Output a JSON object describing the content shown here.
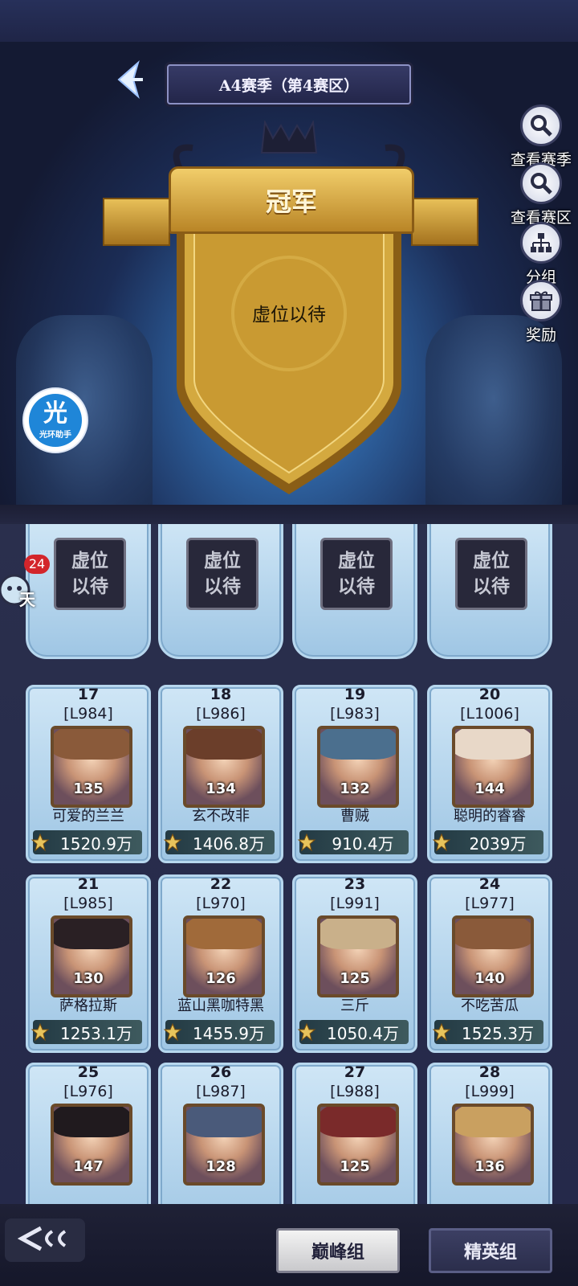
{
  "header": {
    "title": "A4赛季（第4赛区）",
    "back_icon": "back-arrow-icon"
  },
  "side_buttons": [
    {
      "label": "查看赛季",
      "icon": "search-icon"
    },
    {
      "label": "查看赛区",
      "icon": "search-icon"
    },
    {
      "label": "分组",
      "icon": "group-tree-icon"
    },
    {
      "label": "奖励",
      "icon": "gift-icon"
    }
  ],
  "champion": {
    "banner": "冠军",
    "placeholder": "虚位以待"
  },
  "helper": {
    "glyph": "光",
    "label": "光环助手"
  },
  "chat": {
    "badge": "24",
    "label": "天"
  },
  "placeholder_slots": [
    {
      "line1": "虚位",
      "line2": "以待"
    },
    {
      "line1": "虚位",
      "line2": "以待"
    },
    {
      "line1": "虚位",
      "line2": "以待"
    },
    {
      "line1": "虚位",
      "line2": "以待"
    }
  ],
  "players": [
    {
      "rank": "17",
      "level": "[L984]",
      "portrait_value": "135",
      "name": "可爱的兰兰",
      "power": "1520.9万"
    },
    {
      "rank": "18",
      "level": "[L986]",
      "portrait_value": "134",
      "name": "玄不改非",
      "power": "1406.8万"
    },
    {
      "rank": "19",
      "level": "[L983]",
      "portrait_value": "132",
      "name": "曹贼",
      "power": "910.4万"
    },
    {
      "rank": "20",
      "level": "[L1006]",
      "portrait_value": "144",
      "name": "聪明的睿睿",
      "power": "2039万"
    },
    {
      "rank": "21",
      "level": "[L985]",
      "portrait_value": "130",
      "name": "萨格拉斯",
      "power": "1253.1万"
    },
    {
      "rank": "22",
      "level": "[L970]",
      "portrait_value": "126",
      "name": "蓝山黑咖特黑",
      "power": "1455.9万"
    },
    {
      "rank": "23",
      "level": "[L991]",
      "portrait_value": "125",
      "name": "三斤",
      "power": "1050.4万"
    },
    {
      "rank": "24",
      "level": "[L977]",
      "portrait_value": "140",
      "name": "不吃苦瓜",
      "power": "1525.3万"
    },
    {
      "rank": "25",
      "level": "[L976]",
      "portrait_value": "147",
      "name": "",
      "power": ""
    },
    {
      "rank": "26",
      "level": "[L987]",
      "portrait_value": "128",
      "name": "",
      "power": ""
    },
    {
      "rank": "27",
      "level": "[L988]",
      "portrait_value": "125",
      "name": "",
      "power": ""
    },
    {
      "rank": "28",
      "level": "[L999]",
      "portrait_value": "136",
      "name": "",
      "power": ""
    }
  ],
  "tabs": [
    {
      "label": "巅峰组",
      "active": true
    },
    {
      "label": "精英组",
      "active": false
    }
  ],
  "colors": {
    "background": "#1b1d33",
    "card": "#cfe6f6",
    "gold": "#e7c45c",
    "active_tab": "#f3f3f3"
  }
}
